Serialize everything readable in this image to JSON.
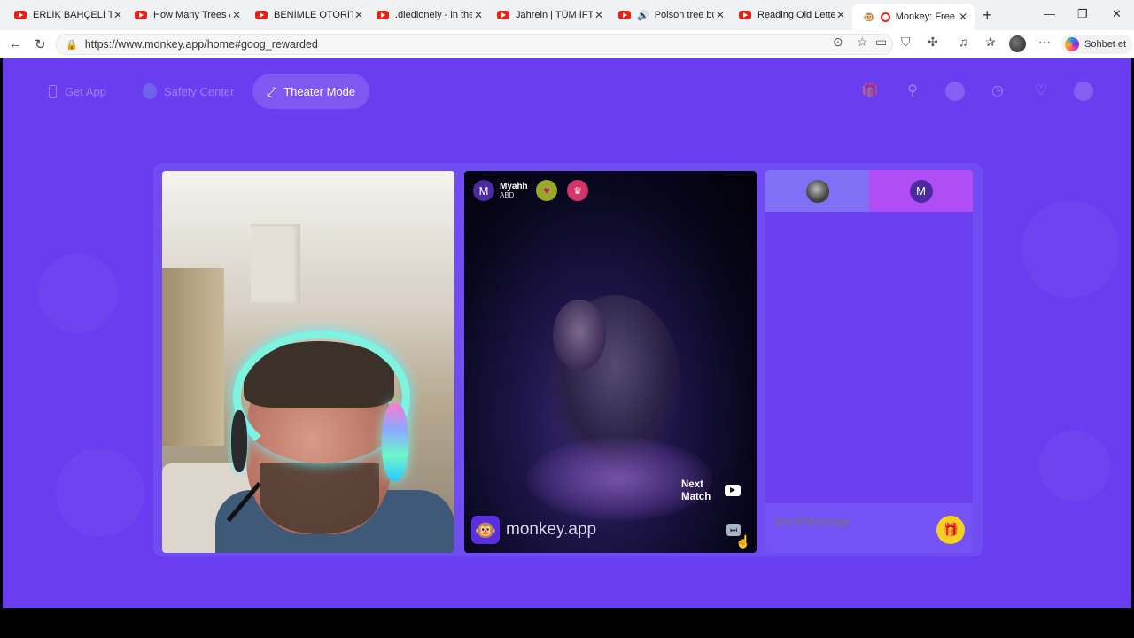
{
  "tabs": [
    {
      "title": "ERLİK BAHÇELİ TAKI"
    },
    {
      "title": "How Many Trees Are"
    },
    {
      "title": "BENİMLE OTORİTE S"
    },
    {
      "title": ".diedlonely - in the l"
    },
    {
      "title": "Jahrein | TÜM İFTİRA"
    },
    {
      "title": "Poison tree but"
    },
    {
      "title": "Reading Old Letters"
    },
    {
      "title": "Monkey: Free L"
    }
  ],
  "address": {
    "url": "https://www.monkey.app/home#goog_rewarded"
  },
  "copilot": {
    "label": "Sohbet et"
  },
  "topnav": {
    "get_app": "Get App",
    "safety_center": "Safety Center",
    "theater_mode": "Theater Mode"
  },
  "remote": {
    "avatar_initial": "M",
    "name": "Myahh",
    "country": "ABD",
    "next_match": "Next Match",
    "brand": "monkey.app"
  },
  "chat": {
    "tab_b_initial": "M",
    "placeholder": "Send Message"
  },
  "colors": {
    "accent": "#6a3df0",
    "chat_tab_a": "#8070f5",
    "chat_tab_b": "#b14df5",
    "gift": "#f5d020"
  }
}
